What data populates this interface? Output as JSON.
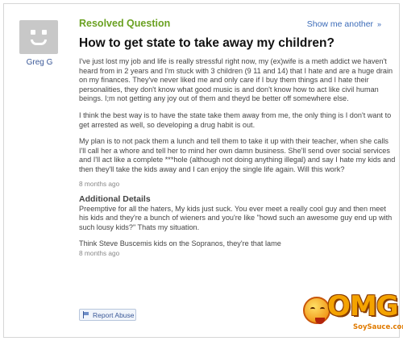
{
  "user": {
    "name": "Greg G",
    "avatar_icon": "default-avatar-icon"
  },
  "header": {
    "status": "Resolved Question",
    "show_me_another": "Show me another",
    "show_me_icon": "double-chevron-right-icon"
  },
  "question": {
    "title": "How to get state to take away my children?",
    "paragraphs": [
      "I've just lost my job and life is really stressful right now, my (ex)wife is a meth addict we haven't heard from in 2 years and I'm stuck with 3 children (9 11 and 14) that I hate and are a huge drain on my finances. They've never liked me and only care if I buy them things and I hate their personalities, they don't know what good music is and don't know how to act like civil human beings. I;m not getting any joy out of them and theyd be better off somewhere else.",
      "I think the best way is to have the state take them away from me, the only thing is I don't want to get arrested as well, so developing a drug habit is out.",
      "My plan is to not pack them a lunch and tell them to take it up with their teacher, when she calls I'll call her a whore and tell her to mind her own damn business. She'll send over social services and I'll act like a complete ***hole (although not doing anything illegal) and say I hate my kids and then they'll take the kids away and I can enjoy the single life again. Will this work?"
    ],
    "time": "8 months ago"
  },
  "additional": {
    "heading": "Additional Details",
    "paragraphs": [
      "Preemptive for all the haters, My kids just suck. You ever meet a really cool guy and then meet his kids and they're a bunch of wieners and you're like \"howd such an awesome guy end up with such lousy kids?\" Thats my situation.",
      "Think Steve Buscemis kids on the Sopranos, they're that lame"
    ],
    "time": "8 months ago"
  },
  "actions": {
    "report_abuse": "Report Abuse",
    "report_icon": "flag-icon"
  },
  "watermark": {
    "logo": "OMG",
    "site": "SoySauce.com"
  },
  "colors": {
    "resolved_green": "#6aa121",
    "link_blue": "#3b6bb8",
    "username_blue": "#3b5998",
    "watermark_orange": "#f4a300"
  }
}
